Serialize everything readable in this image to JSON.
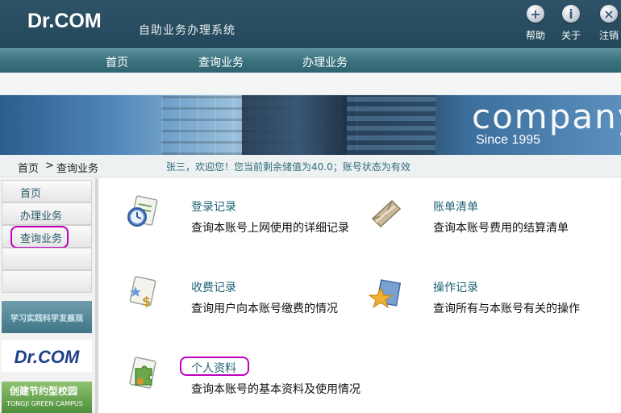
{
  "header": {
    "logo": "Dr.COM",
    "subtitle": "自助业务办理系统",
    "actions": [
      {
        "label": "帮助",
        "icon": "plus-icon",
        "glyph": "+"
      },
      {
        "label": "关于",
        "icon": "info-icon",
        "glyph": "i"
      },
      {
        "label": "注销",
        "icon": "close-icon",
        "glyph": "×"
      }
    ]
  },
  "nav": {
    "items": [
      {
        "label": "首页"
      },
      {
        "label": "查询业务"
      },
      {
        "label": "办理业务"
      }
    ]
  },
  "banner": {
    "company": "company",
    "since": "Since 1995"
  },
  "breadcrumb": {
    "home": "首页",
    "separator": ">",
    "current": "查询业务",
    "welcome": "张三，欢迎您！您当前剩余储值为40.0；账号状态为有效"
  },
  "sidebar": {
    "items": [
      {
        "label": "首页"
      },
      {
        "label": "办理业务"
      },
      {
        "label": "查询业务"
      }
    ],
    "ads": {
      "ad1": "学习实践科学发展观",
      "ad2": "Dr.COM",
      "ad3_line1": "创建节约型校园",
      "ad3_line2": "TONGJI GREEN CAMPUS"
    }
  },
  "cards": [
    {
      "title": "登录记录",
      "desc": "查询本账号上网使用的详细记录",
      "icon": "clock-document-icon"
    },
    {
      "title": "账单清单",
      "desc": "查询本账号费用的结算清单",
      "icon": "envelope-icon"
    },
    {
      "title": "收费记录",
      "desc": "查询用户向本账号缴费的情况",
      "icon": "dollar-document-icon"
    },
    {
      "title": "操作记录",
      "desc": "查询所有与本账号有关的操作",
      "icon": "star-folder-icon"
    },
    {
      "title": "个人资料",
      "desc": "查询本账号的基本资料及使用情况",
      "icon": "puzzle-document-icon"
    }
  ],
  "colors": {
    "header_bg": "#2e5366",
    "nav_bg": "#3f7481",
    "link_teal": "#1e6477",
    "highlight_magenta": "#c000c0"
  }
}
